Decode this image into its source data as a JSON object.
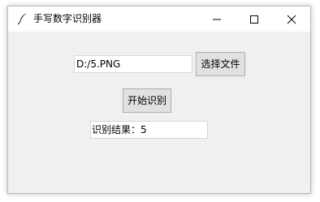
{
  "window": {
    "title": "手写数字识别器",
    "icon": "feather-icon"
  },
  "form": {
    "path_value": "D:/5.PNG",
    "choose_file_label": "选择文件",
    "start_label": "开始识别",
    "result_value": "识别结果：5"
  },
  "caption_buttons": [
    "minimize-icon",
    "maximize-icon",
    "close-icon"
  ]
}
